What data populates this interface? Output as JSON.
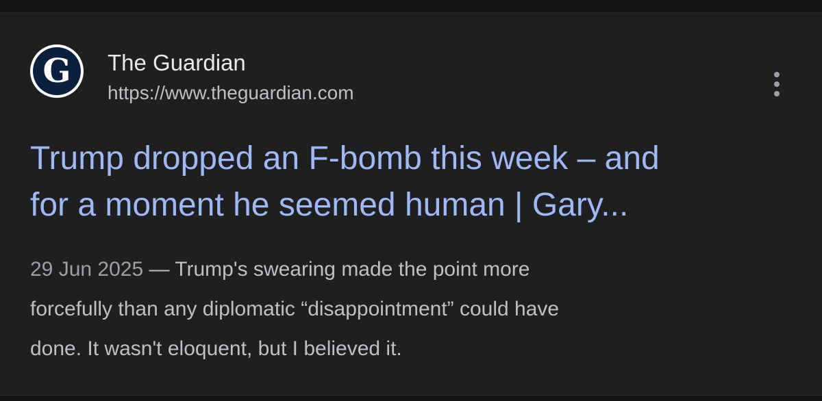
{
  "result": {
    "source": {
      "name": "The Guardian",
      "url": "https://www.theguardian.com",
      "logo_letter": "G"
    },
    "title_lines": [
      "Trump dropped an F-bomb this week – and",
      "for a moment he seemed human | Gary..."
    ],
    "date": "29 Jun 2025",
    "separator": " — ",
    "snippet_lines": [
      "Trump's swearing made the point more",
      "forcefully than any diplomatic “disappointment” could have",
      "done. It wasn't eloquent, but I believed it."
    ],
    "menu_icon": "more-vert-icon"
  },
  "colors": {
    "background": "#1f1f1f",
    "title": "#9fb8f6",
    "site_name": "#e8eaed",
    "text": "#bdc1c6",
    "logo_bg": "#0b1f3f"
  }
}
